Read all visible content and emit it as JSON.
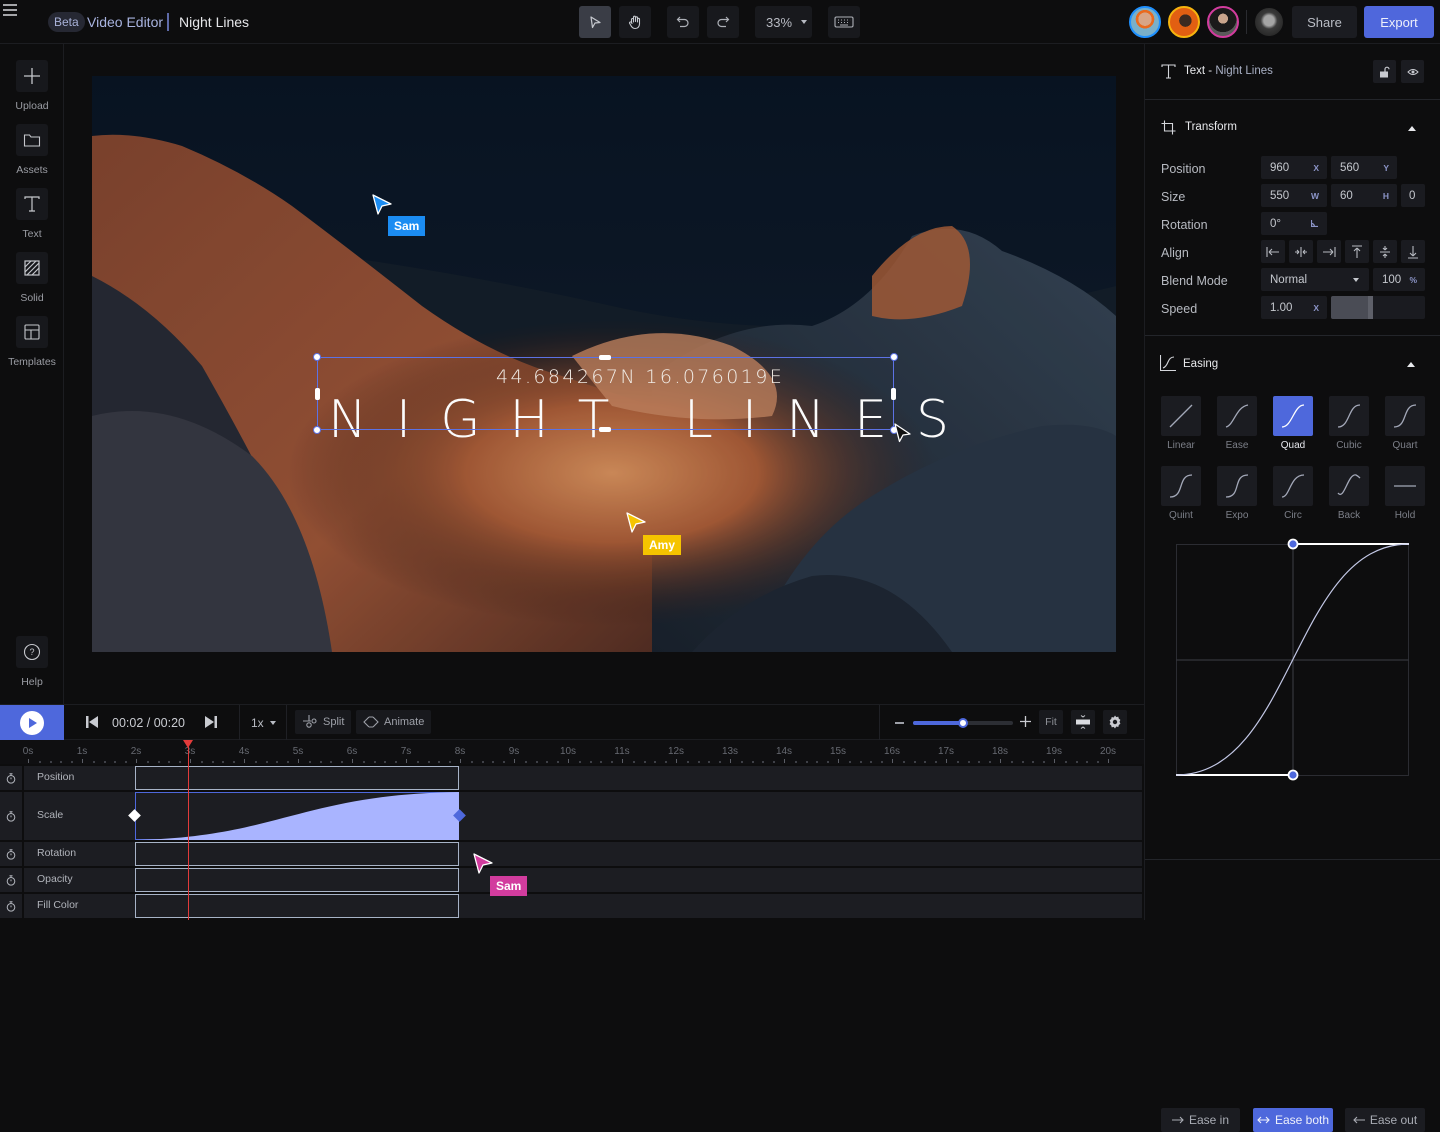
{
  "topbar": {
    "beta_badge": "Beta",
    "app_title": "Video Editor",
    "document_title": "Night Lines",
    "zoom_level": "33%",
    "share_label": "Share",
    "export_label": "Export",
    "collaborators": [
      {
        "name": "collaborator-1",
        "ring_color": "#1e90ff"
      },
      {
        "name": "collaborator-2",
        "ring_color": "#f6b40e"
      },
      {
        "name": "collaborator-3",
        "ring_color": "#d23c9e"
      },
      {
        "name": "current-user",
        "ring_color": "#0d0d0e"
      }
    ]
  },
  "sidebar": {
    "items": [
      {
        "label": "Upload",
        "icon": "plus-icon"
      },
      {
        "label": "Assets",
        "icon": "folder-icon"
      },
      {
        "label": "Text",
        "icon": "text-icon"
      },
      {
        "label": "Solid",
        "icon": "hatched-square-icon"
      },
      {
        "label": "Templates",
        "icon": "layout-icon"
      }
    ],
    "help_label": "Help"
  },
  "canvas": {
    "coordinates_text": "44.684267N 16.076019E",
    "title_text": "NIGHT LINES",
    "cursors": [
      {
        "name": "Sam",
        "color": "#1b8cf2"
      },
      {
        "name": "Amy",
        "color": "#f5c400"
      }
    ]
  },
  "panel": {
    "layer_type": "Text",
    "layer_name": "Night Lines",
    "transform": {
      "title": "Transform",
      "position_label": "Position",
      "position_x": "960",
      "position_x_unit": "X",
      "position_y": "560",
      "position_y_unit": "Y",
      "size_label": "Size",
      "size_w": "550",
      "size_w_unit": "W",
      "size_h": "60",
      "size_h_unit": "H",
      "size_extra": "0",
      "rotation_label": "Rotation",
      "rotation": "0°",
      "align_label": "Align",
      "blend_label": "Blend Mode",
      "blend_mode": "Normal",
      "opacity": "100",
      "opacity_unit": "%",
      "speed_label": "Speed",
      "speed": "1.00",
      "speed_unit": "X",
      "speed_slider_fraction": 0.45
    },
    "easing": {
      "title": "Easing",
      "presets": [
        "Linear",
        "Ease",
        "Quad",
        "Cubic",
        "Quart",
        "Quint",
        "Expo",
        "Circ",
        "Back",
        "Hold"
      ],
      "selected": "Quad",
      "ease_in_label": "Ease in",
      "ease_both_label": "Ease both",
      "ease_out_label": "Ease out",
      "selected_direction": "Ease both"
    }
  },
  "transport": {
    "timecode": "00:02 / 00:20",
    "speed": "1x",
    "split_label": "Split",
    "animate_label": "Animate",
    "fit_label": "Fit",
    "timeline_zoom_fraction": 0.5
  },
  "timeline": {
    "ruler": [
      "0s",
      "1s",
      "2s",
      "3s",
      "4s",
      "5s",
      "6s",
      "7s",
      "8s",
      "9s",
      "10s",
      "11s",
      "12s",
      "13s",
      "14s",
      "15s",
      "16s",
      "17s",
      "18s",
      "19s",
      "20s"
    ],
    "playhead_seconds": 3,
    "clip_start_seconds": 2,
    "clip_end_seconds": 8,
    "tracks": [
      {
        "name": "Position"
      },
      {
        "name": "Scale",
        "keyframes": [
          2,
          8
        ],
        "active": true
      },
      {
        "name": "Rotation"
      },
      {
        "name": "Opacity"
      },
      {
        "name": "Fill Color"
      }
    ],
    "cursor": {
      "name": "Sam",
      "color": "#d23c9e"
    }
  },
  "colors": {
    "accent": "#4e68dc",
    "playhead": "#e23b3b",
    "scale_curve_fill": "#a9b4ff"
  }
}
